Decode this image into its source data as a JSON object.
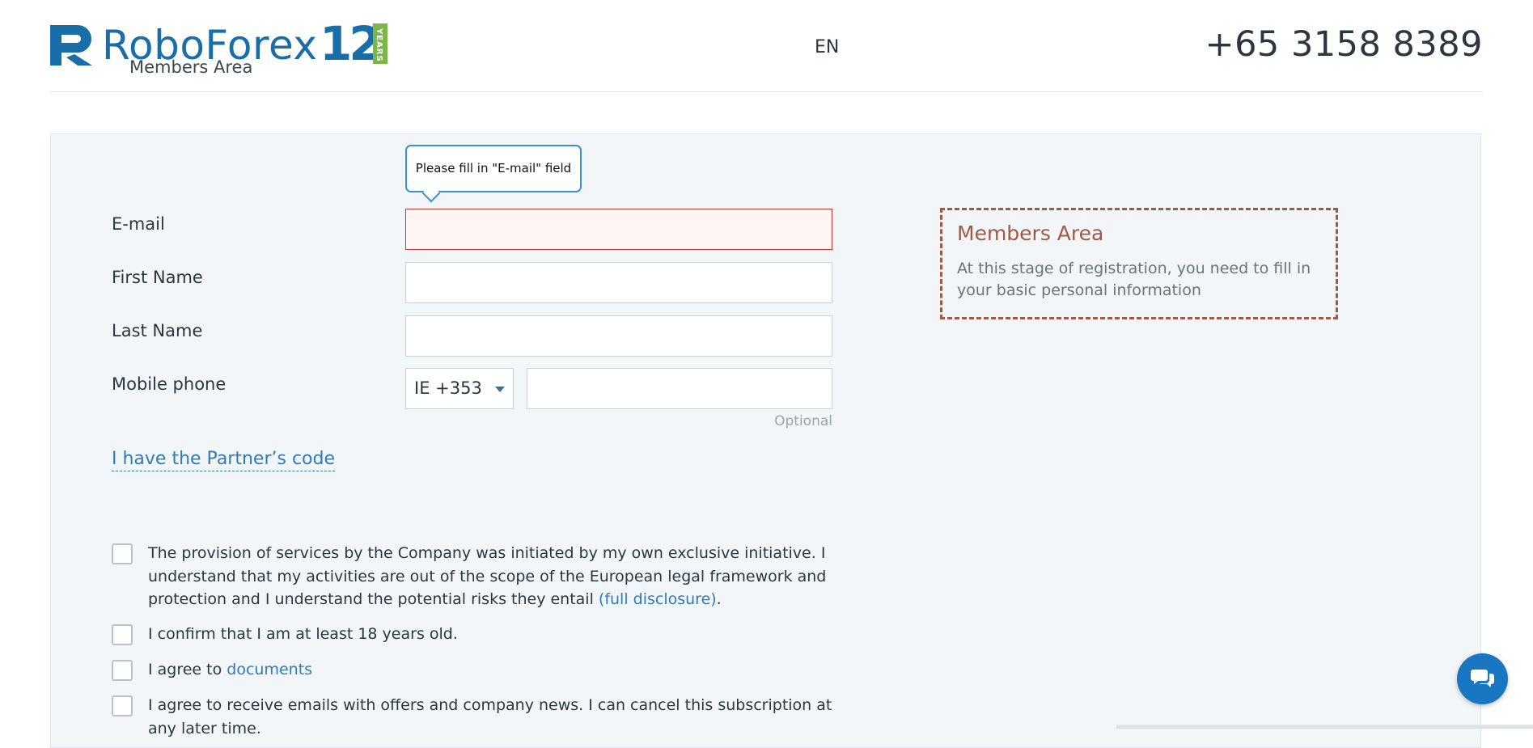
{
  "header": {
    "logo_text": "RoboForex",
    "logo_years_number": "12",
    "logo_years_label": "YEARS",
    "logo_subtitle": "Members Area",
    "language": "EN",
    "phone": "+65 3158 8389"
  },
  "form": {
    "tooltip": "Please fill in \"E-mail\" field",
    "email_label": "E-mail",
    "first_name_label": "First Name",
    "last_name_label": "Last Name",
    "mobile_label": "Mobile phone",
    "country_code": "IE +353",
    "optional_label": "Optional",
    "partner_link": "I have the Partner’s code"
  },
  "checkboxes": {
    "initiative_text": "The provision of services by the Company was initiated by my own exclusive initiative. I understand that my activities are out of the scope of the European legal framework and protection and I understand the potential risks they entail ",
    "initiative_link": "(full disclosure)",
    "initiative_end": ".",
    "age_text": "I confirm that I am at least 18 years old.",
    "agree_text": "I agree to ",
    "agree_link": "documents",
    "emails_text": "I agree to receive emails with offers and company news. I can cancel this subscription at any later time."
  },
  "info_box": {
    "title": "Members Area",
    "text": "At this stage of registration, you need to fill in your basic personal information"
  },
  "colors": {
    "brand_blue": "#1a6ea8",
    "link_blue": "#2d7cb8",
    "error_red": "#c0392b",
    "info_border": "#a05a44",
    "years_green": "#7ab648"
  },
  "icons": {
    "chat": "chat-bubbles-icon",
    "dropdown": "caret-down-icon",
    "logo": "roboforex-logo-icon"
  }
}
